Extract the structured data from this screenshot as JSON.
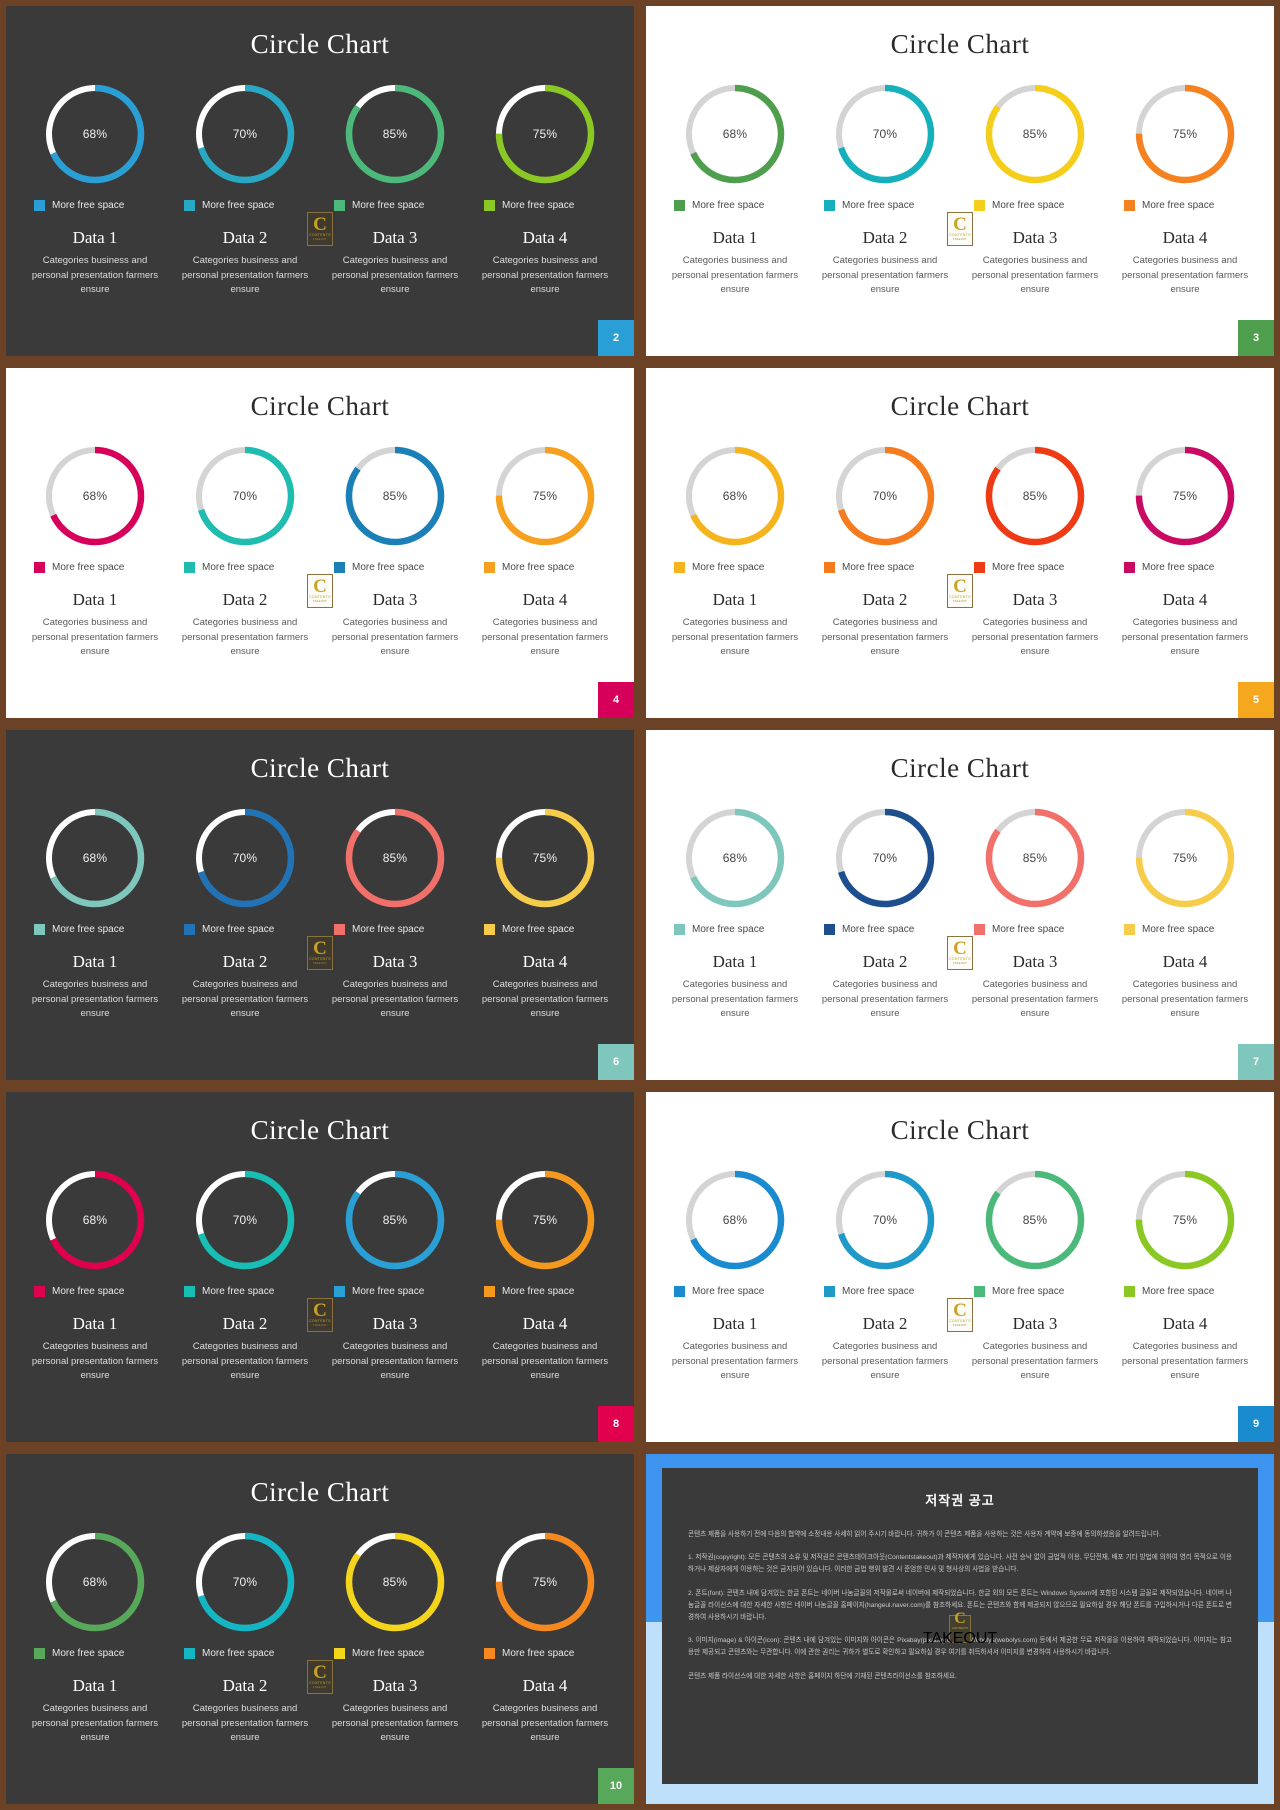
{
  "common": {
    "title": "Circle Chart",
    "legend_label": "More free space",
    "description": "Categories business and personal presentation farmers ensure",
    "watermark": {
      "letter": "C",
      "line1": "CONTENTS",
      "line2": "TAKEOUT"
    }
  },
  "chart_data": {
    "type": "pie",
    "title": "Circle Chart",
    "categories": [
      "Data 1",
      "Data 2",
      "Data 3",
      "Data 4"
    ],
    "values": [
      68,
      70,
      85,
      75
    ],
    "value_labels": [
      "68%",
      "70%",
      "85%",
      "75%"
    ],
    "legend": [
      "More free space",
      "More free space",
      "More free space",
      "More free space"
    ],
    "legend_position": "below-each-donut",
    "notes": "Four donut/ring gauges per slide; ring track is white on dark slides and light-grey on light slides"
  },
  "slides": [
    {
      "number": "2",
      "theme": "dark",
      "badge_color": "#2a9fd6",
      "track": "#ffffff",
      "items": [
        {
          "name": "Data 1",
          "pct": 68,
          "label": "68%",
          "color": "#2a9fd6"
        },
        {
          "name": "Data 2",
          "pct": 70,
          "label": "70%",
          "color": "#29a8c4"
        },
        {
          "name": "Data 3",
          "pct": 85,
          "label": "85%",
          "color": "#4cb97a"
        },
        {
          "name": "Data 4",
          "pct": 75,
          "label": "75%",
          "color": "#8bc824"
        }
      ]
    },
    {
      "number": "3",
      "theme": "light",
      "badge_color": "#4e9e4e",
      "track": "#d4d4d4",
      "items": [
        {
          "name": "Data 1",
          "pct": 68,
          "label": "68%",
          "color": "#4e9e4e"
        },
        {
          "name": "Data 2",
          "pct": 70,
          "label": "70%",
          "color": "#16b0bd"
        },
        {
          "name": "Data 3",
          "pct": 85,
          "label": "85%",
          "color": "#f5ce1b"
        },
        {
          "name": "Data 4",
          "pct": 75,
          "label": "75%",
          "color": "#f58220"
        }
      ]
    },
    {
      "number": "4",
      "theme": "light",
      "badge_color": "#d6005a",
      "track": "#d4d4d4",
      "items": [
        {
          "name": "Data 1",
          "pct": 68,
          "label": "68%",
          "color": "#d6005a"
        },
        {
          "name": "Data 2",
          "pct": 70,
          "label": "70%",
          "color": "#1fbcb0"
        },
        {
          "name": "Data 3",
          "pct": 85,
          "label": "85%",
          "color": "#1b7fb8"
        },
        {
          "name": "Data 4",
          "pct": 75,
          "label": "75%",
          "color": "#f5a01e"
        }
      ]
    },
    {
      "number": "5",
      "theme": "light",
      "badge_color": "#f5a81e",
      "track": "#d4d4d4",
      "items": [
        {
          "name": "Data 1",
          "pct": 68,
          "label": "68%",
          "color": "#f5b31e"
        },
        {
          "name": "Data 2",
          "pct": 70,
          "label": "70%",
          "color": "#f57c1e"
        },
        {
          "name": "Data 3",
          "pct": 85,
          "label": "85%",
          "color": "#ee3b16"
        },
        {
          "name": "Data 4",
          "pct": 75,
          "label": "75%",
          "color": "#c90a63"
        }
      ]
    },
    {
      "number": "6",
      "theme": "dark",
      "badge_color": "#7fc6bc",
      "track": "#ffffff",
      "items": [
        {
          "name": "Data 1",
          "pct": 68,
          "label": "68%",
          "color": "#7fc6bc"
        },
        {
          "name": "Data 2",
          "pct": 70,
          "label": "70%",
          "color": "#2273b5"
        },
        {
          "name": "Data 3",
          "pct": 85,
          "label": "85%",
          "color": "#f2706a"
        },
        {
          "name": "Data 4",
          "pct": 75,
          "label": "75%",
          "color": "#f5cd4a"
        }
      ]
    },
    {
      "number": "7",
      "theme": "light",
      "badge_color": "#7fc6bc",
      "track": "#d4d4d4",
      "items": [
        {
          "name": "Data 1",
          "pct": 68,
          "label": "68%",
          "color": "#7fc6bc"
        },
        {
          "name": "Data 2",
          "pct": 70,
          "label": "70%",
          "color": "#1d4f8f"
        },
        {
          "name": "Data 3",
          "pct": 85,
          "label": "85%",
          "color": "#f2706a"
        },
        {
          "name": "Data 4",
          "pct": 75,
          "label": "75%",
          "color": "#f5cd4a"
        }
      ]
    },
    {
      "number": "8",
      "theme": "dark",
      "badge_color": "#e0004d",
      "track": "#ffffff",
      "items": [
        {
          "name": "Data 1",
          "pct": 68,
          "label": "68%",
          "color": "#e0004d"
        },
        {
          "name": "Data 2",
          "pct": 70,
          "label": "70%",
          "color": "#18bdb3"
        },
        {
          "name": "Data 3",
          "pct": 85,
          "label": "85%",
          "color": "#2a9fd6"
        },
        {
          "name": "Data 4",
          "pct": 75,
          "label": "75%",
          "color": "#f5981e"
        }
      ]
    },
    {
      "number": "9",
      "theme": "light",
      "badge_color": "#1b8bd0",
      "track": "#d4d4d4",
      "items": [
        {
          "name": "Data 1",
          "pct": 68,
          "label": "68%",
          "color": "#1b8bd0"
        },
        {
          "name": "Data 2",
          "pct": 70,
          "label": "70%",
          "color": "#1f9ac8"
        },
        {
          "name": "Data 3",
          "pct": 85,
          "label": "85%",
          "color": "#4cb97a"
        },
        {
          "name": "Data 4",
          "pct": 75,
          "label": "75%",
          "color": "#8bc824"
        }
      ]
    },
    {
      "number": "10",
      "theme": "dark",
      "badge_color": "#57a85a",
      "track": "#ffffff",
      "items": [
        {
          "name": "Data 1",
          "pct": 68,
          "label": "68%",
          "color": "#57a85a"
        },
        {
          "name": "Data 2",
          "pct": 70,
          "label": "70%",
          "color": "#14b6c4"
        },
        {
          "name": "Data 3",
          "pct": 85,
          "label": "85%",
          "color": "#f5d51b"
        },
        {
          "name": "Data 4",
          "pct": 75,
          "label": "75%",
          "color": "#f5881e"
        }
      ]
    }
  ],
  "copyright": {
    "title": "저작권 공고",
    "paragraphs": [
      "콘텐츠 제품을 사용하기 전에 다음의 협약에 소정내용 사세히 읽어 주시기 바랍니다. 귀하가 이 콘텐츠 제품을 사용하는 것은 사용자 계약에 보증에 동의하셨음을 알려드립니다.",
      "1. 저작권(copyright): 모든 콘텐츠의 소유 및 저작권은 콘텐츠테이크아웃(Contentstakeout)과 제작자에게 있습니다. 사전 승낙 없이 금법적 이용, 무단전재, 배포 기타 방법에 의하여 영리 목적으로 이용하거나 제삼자에게 이용하는 것은 금지되어 있습니다. 이러한 금법 행위 발견 시 준엄한 민사 및 형사상의 사법을 받습니다.",
      "2. 폰트(font): 콘텐츠 내에 담겨있는 한글 폰트는 네이버 나눔글꼴의 저작물로써 네이버에 제작되었습니다. 한글 외의 모든 폰트는 Windows System에 포함된 시스템 글꼴로 제작되었습니다. 네이버 나눔글꼴 라이선스에 대한 자세한 사항은 네이버 나눔글꼴 홈페이지(hangeul.naver.com)를 참조하세요. 폰트는 콘텐츠와 함께 제공되지 않으므로 필요하실 경우 해당 폰트를 구입하시거나 다른 폰트로 변경하여 사용하시기 바랍니다.",
      "3. 이미지(image) & 아이콘(icon): 콘텐츠 내에 담겨있는 이미지와 아이콘은 Pixabay(pixabay.com)와 Webolys(webolys.com) 등에서 제공한 무료 저작물을 이용하여 제작되었습니다. 이미지는 참고용만 제공되고 콘텐츠와는 무관합니다. 이에 관한 권리는 귀하가 별도로 확인하고 필요하실 경우 여기를 취득하셔서 이미지를 변경하여 사용하시기 바랍니다.",
      "콘텐츠 제품 라이선스에 대한 자세한 사항은 홈페이지 하단에 기재된 콘텐츠라이선스를 참조하세요."
    ]
  }
}
